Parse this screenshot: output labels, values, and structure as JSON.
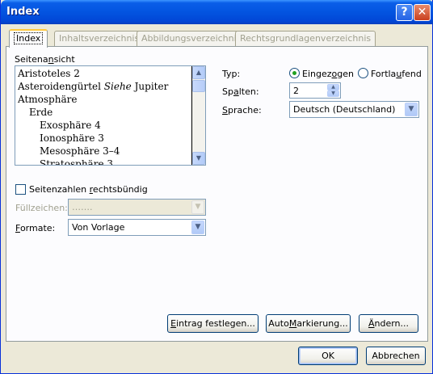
{
  "window": {
    "title": "Index",
    "help_glyph": "?",
    "close_glyph": "✕"
  },
  "tabs": [
    {
      "label": "Index",
      "active": true
    },
    {
      "label": "Inhaltsverzeichnis",
      "active": false
    },
    {
      "label": "Abbildungsverzeichnis",
      "active": false
    },
    {
      "label": "Rechtsgrundlagenverzeichnis",
      "active": false
    }
  ],
  "preview": {
    "label_pre": "Seitena",
    "label_key": "n",
    "label_post": "sicht",
    "lines": [
      {
        "text": "Aristoteles  2"
      },
      {
        "text": "Asteroidengürtel  ",
        "italic": "Siehe",
        "rest": " Jupiter"
      },
      {
        "text": "Atmosphäre"
      },
      {
        "text": "Erde"
      },
      {
        "text": "Exosphäre  4"
      },
      {
        "text": "Ionosphäre  3"
      },
      {
        "text": "Mesosphäre  3–4"
      },
      {
        "text": "Stratosphäre  3"
      }
    ]
  },
  "right_align": {
    "label_pre": "Seitenzahlen ",
    "label_key": "r",
    "label_post": "echtsbündig",
    "checked": false
  },
  "fill_char": {
    "label": "Füllzeichen:",
    "value": "……."
  },
  "formats": {
    "label_key": "F",
    "label_post": "ormate:",
    "value": "Von Vorlage"
  },
  "type": {
    "label": "Typ:",
    "option1_pre": "Eingez",
    "option1_key": "o",
    "option1_post": "gen",
    "option2_pre": "Fortla",
    "option2_key": "u",
    "option2_post": "fend",
    "selected": "Eingezogen"
  },
  "columns": {
    "label_pre": "Sp",
    "label_key": "a",
    "label_post": "lten:",
    "value": "2"
  },
  "language": {
    "label_key": "S",
    "label_post": "prache:",
    "value": "Deutsch (Deutschland)"
  },
  "buttons": {
    "mark_entry_key": "E",
    "mark_entry_post": "intrag festlegen...",
    "automark_pre": "Auto",
    "automark_key": "M",
    "automark_post": "arkierung...",
    "modify_key": "Ä",
    "modify_post": "ndern...",
    "ok": "OK",
    "cancel": "Abbrechen"
  }
}
